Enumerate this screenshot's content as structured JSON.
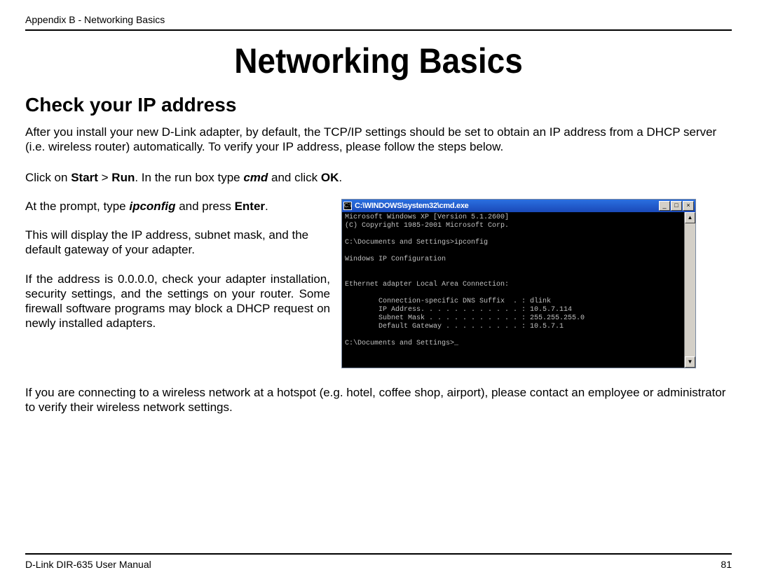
{
  "header": {
    "breadcrumb": "Appendix B - Networking Basics"
  },
  "title": "Networking Basics",
  "subtitle": "Check your IP address",
  "intro": "After you install your new D-Link adapter, by default, the TCP/IP settings should be set to obtain an IP address from a DHCP server (i.e. wireless router) automatically. To verify your IP address, please follow the steps below.",
  "step1": {
    "pre1": "Click on ",
    "b1": "Start",
    "mid1": " > ",
    "b2": "Run",
    "mid2": ". In the run box type ",
    "i1": "cmd",
    "mid3": " and click ",
    "b3": "OK",
    "post": "."
  },
  "left": {
    "p1_pre": "At the prompt, type ",
    "p1_i": "ipconfig",
    "p1_mid": " and press ",
    "p1_b": "Enter",
    "p1_post": ".",
    "p2": "This will display the IP address, subnet mask, and the default gateway of your adapter.",
    "p3": "If the address is 0.0.0.0, check your adapter installation, security settings, and the settings on your router. Some firewall software programs may block a DHCP request on newly installed adapters."
  },
  "cmd": {
    "title": "C:\\WINDOWS\\system32\\cmd.exe",
    "min": "_",
    "max": "□",
    "close": "×",
    "up": "▲",
    "down": "▼",
    "output": "Microsoft Windows XP [Version 5.1.2600]\n(C) Copyright 1985-2001 Microsoft Corp.\n\nC:\\Documents and Settings>ipconfig\n\nWindows IP Configuration\n\n\nEthernet adapter Local Area Connection:\n\n        Connection-specific DNS Suffix  . : dlink\n        IP Address. . . . . . . . . . . . : 10.5.7.114\n        Subnet Mask . . . . . . . . . . . : 255.255.255.0\n        Default Gateway . . . . . . . . . : 10.5.7.1\n\nC:\\Documents and Settings>_"
  },
  "outro": "If you are connecting to a wireless network at a hotspot (e.g. hotel, coffee shop, airport), please contact an employee or administrator to verify their wireless network settings.",
  "footer": {
    "manual": "D-Link DIR-635 User Manual",
    "page": "81"
  }
}
